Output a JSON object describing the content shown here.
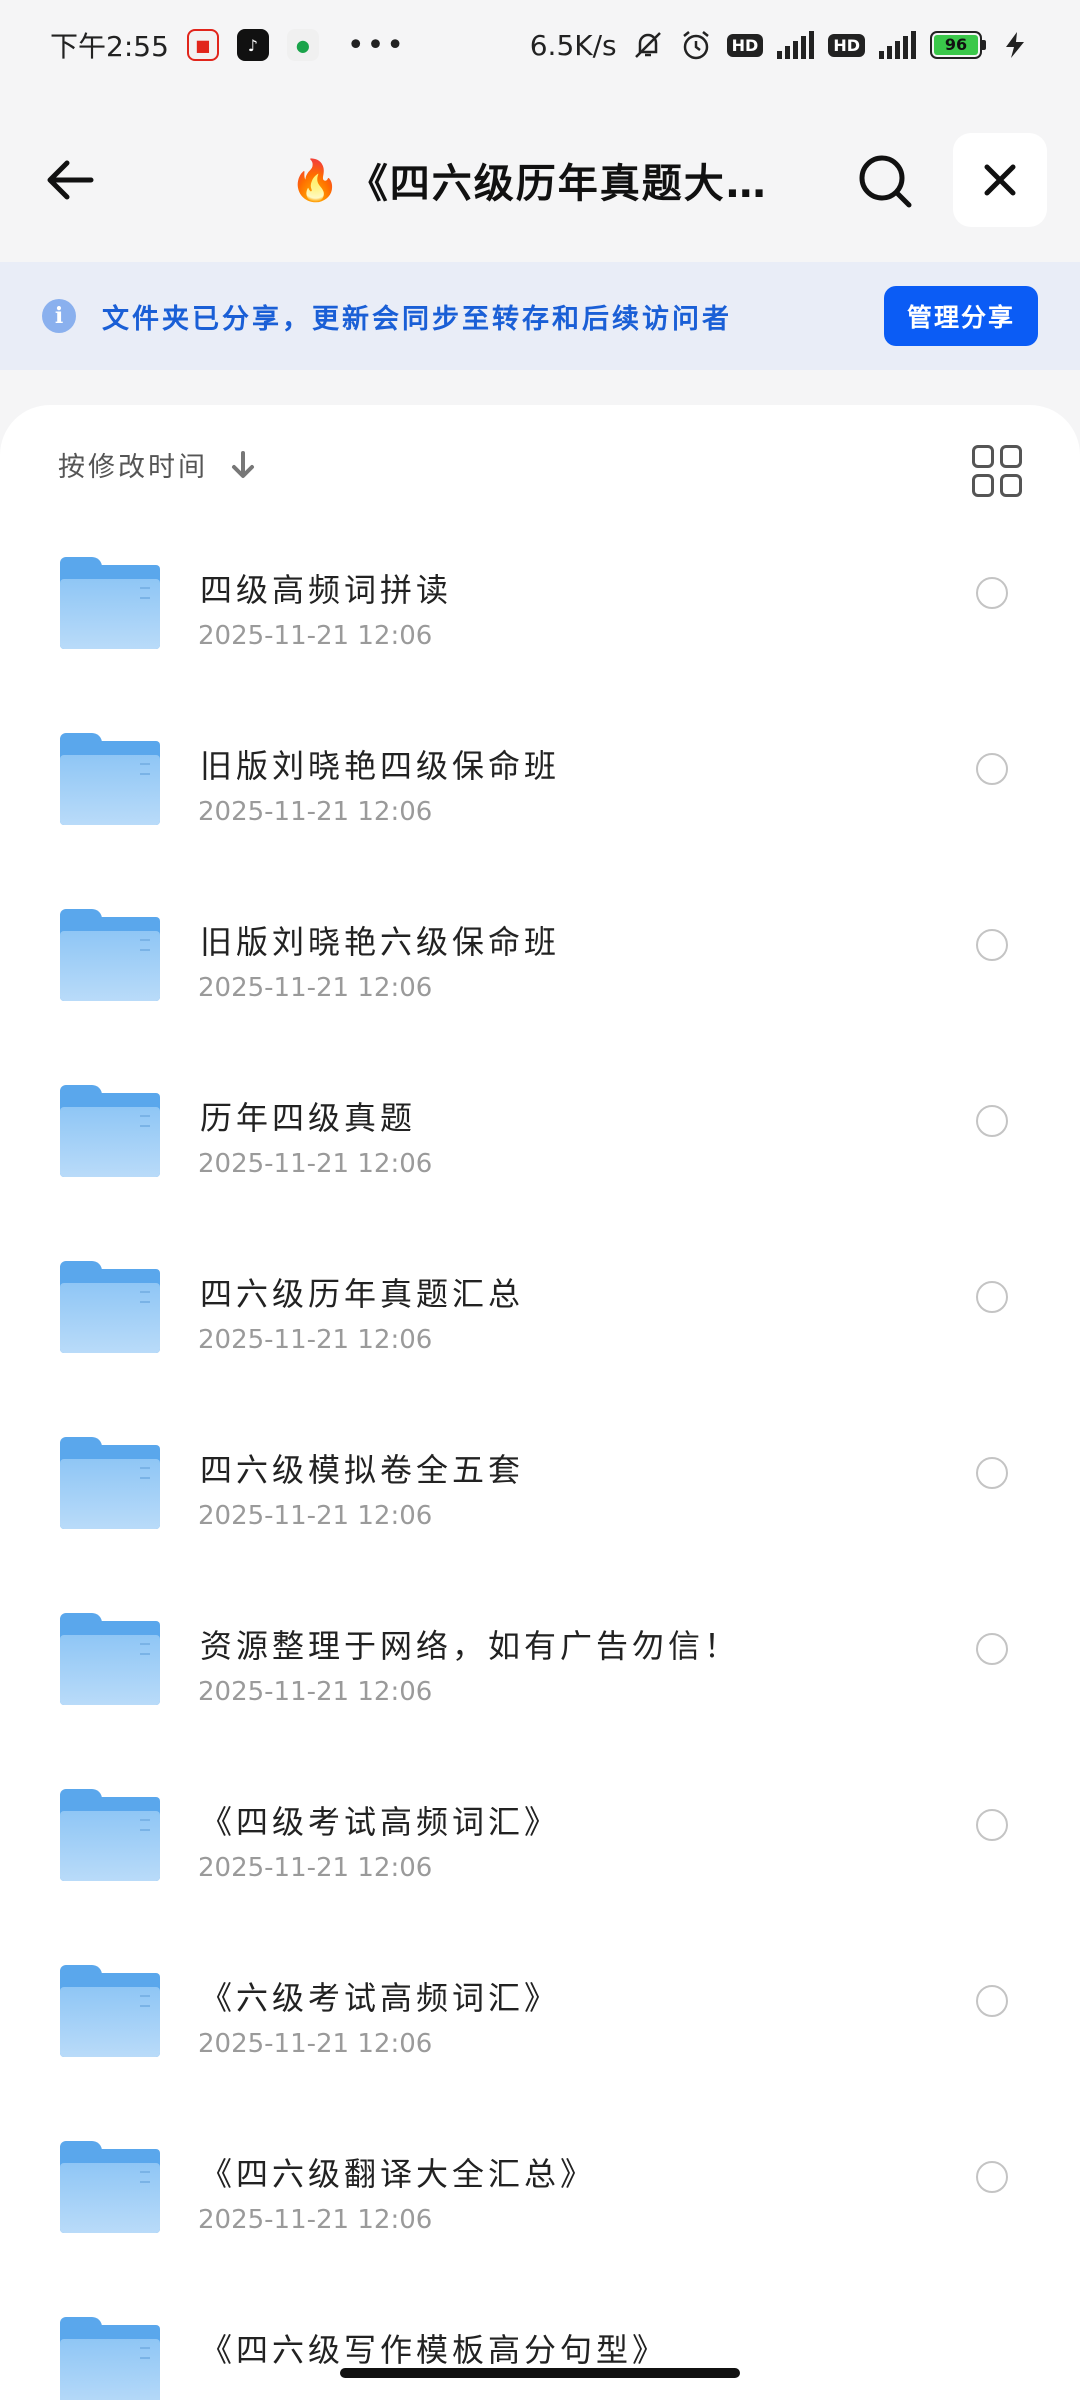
{
  "status_bar": {
    "time": "下午2:55",
    "app_icons": [
      "notification-app-icon",
      "tiktok-icon",
      "music-app-icon"
    ],
    "more": "•••",
    "net_speed": "6.5K/s",
    "hd1": "HD",
    "network1": "4G",
    "hd2": "HD",
    "network2": "5G",
    "battery": "96"
  },
  "header": {
    "back_icon": "arrow-left-icon",
    "title_emoji": "🔥",
    "title": "《四六级历年真题大…",
    "search_icon": "search-icon",
    "close_icon": "close-icon"
  },
  "banner": {
    "icon": "info-icon",
    "text": "文件夹已分享，更新会同步至转存和后续访问者",
    "button": "管理分享"
  },
  "sort": {
    "label": "按修改时间",
    "icon": "arrow-down-icon",
    "view_toggle_icon": "grid-view-icon"
  },
  "files": [
    {
      "name": "四级高频词拼读",
      "time": "2025-11-21  12:06"
    },
    {
      "name": "旧版刘晓艳四级保命班",
      "time": "2025-11-21  12:06"
    },
    {
      "name": "旧版刘晓艳六级保命班",
      "time": "2025-11-21  12:06"
    },
    {
      "name": "历年四级真题",
      "time": "2025-11-21  12:06"
    },
    {
      "name": "四六级历年真题汇总",
      "time": "2025-11-21  12:06"
    },
    {
      "name": "四六级模拟卷全五套",
      "time": "2025-11-21  12:06"
    },
    {
      "name": "资源整理于网络，如有广告勿信！",
      "time": "2025-11-21  12:06"
    },
    {
      "name": "《四级考试高频词汇》",
      "time": "2025-11-21  12:06"
    },
    {
      "name": "《六级考试高频词汇》",
      "time": "2025-11-21  12:06"
    },
    {
      "name": "《四六级翻译大全汇总》",
      "time": "2025-11-21  12:06"
    },
    {
      "name": "《四六级写作模板高分句型》",
      "time": ""
    }
  ],
  "colors": {
    "accent": "#0b5cf5",
    "banner_bg": "#e9edf7",
    "banner_text": "#1a5fd6",
    "folder": "#5aa7ec"
  }
}
